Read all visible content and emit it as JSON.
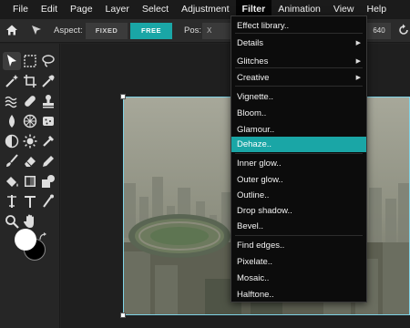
{
  "menubar": {
    "items": [
      {
        "label": "File"
      },
      {
        "label": "Edit"
      },
      {
        "label": "Page"
      },
      {
        "label": "Layer"
      },
      {
        "label": "Select"
      },
      {
        "label": "Adjustment"
      },
      {
        "label": "Filter",
        "active": true
      },
      {
        "label": "Animation"
      },
      {
        "label": "View"
      },
      {
        "label": "Help"
      }
    ]
  },
  "toolbar": {
    "aspect_label": "Aspect:",
    "fixed_label": "FIXED",
    "free_label": "FREE",
    "pos_label": "Pos:",
    "pos_x_placeholder": "X",
    "size_value": "640",
    "accent_color": "#1aa6a6"
  },
  "tools": [
    "select-arrow-icon",
    "marquee-icon",
    "lasso-icon",
    "magic-wand-icon",
    "crop-icon",
    "eyedropper-icon",
    "liquify-icon",
    "bandage-icon",
    "stamp-icon",
    "blur-drop-icon",
    "sharpen-icon",
    "sponge-icon",
    "dodge-icon",
    "burn-icon",
    "color-replace-icon",
    "brush-icon",
    "eraser-icon",
    "pencil-icon",
    "paint-bucket-icon",
    "gradient-icon",
    "shape-icon",
    "smudge-icon",
    "text-icon",
    "pen-icon",
    "zoom-icon",
    "hand-icon"
  ],
  "colors": {
    "foreground": "#ffffff",
    "background": "#000000"
  },
  "filter_menu": {
    "items": [
      {
        "label": "Effect library..",
        "submenu": false
      },
      {
        "label": "Details",
        "submenu": true
      },
      {
        "label": "Glitches",
        "submenu": true
      },
      {
        "label": "Creative",
        "submenu": true
      },
      {
        "label": "Vignette..",
        "submenu": false
      },
      {
        "label": "Bloom..",
        "submenu": false
      },
      {
        "label": "Glamour..",
        "submenu": false
      },
      {
        "label": "Dehaze..",
        "submenu": false,
        "highlighted": true
      },
      {
        "label": "Inner glow..",
        "submenu": false
      },
      {
        "label": "Outer glow..",
        "submenu": false
      },
      {
        "label": "Outline..",
        "submenu": false
      },
      {
        "label": "Drop shadow..",
        "submenu": false
      },
      {
        "label": "Bevel..",
        "submenu": false
      },
      {
        "label": "Find edges..",
        "submenu": false
      },
      {
        "label": "Pixelate..",
        "submenu": false
      },
      {
        "label": "Mosaic..",
        "submenu": false
      },
      {
        "label": "Halftone..",
        "submenu": false
      }
    ]
  }
}
